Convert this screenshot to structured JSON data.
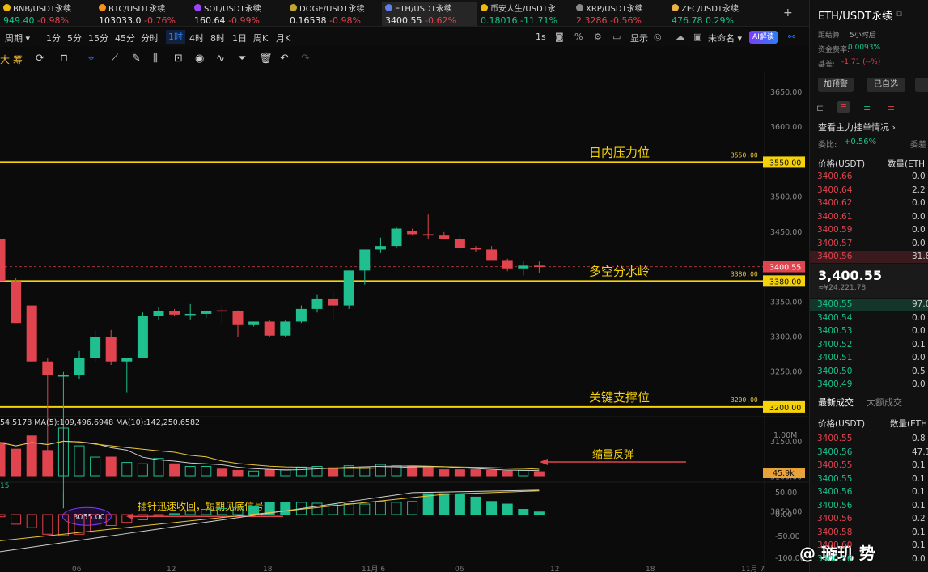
{
  "tickers": [
    {
      "symbol": "BNB/USDT永续",
      "price": "949.40",
      "change": "-0.98%",
      "dir": "neg",
      "color": "#f0b90b"
    },
    {
      "symbol": "BTC/USDT永续",
      "price": "103033.0",
      "change": "-0.76%",
      "dir": "neg",
      "color": "#f7931a"
    },
    {
      "symbol": "SOL/USDT永续",
      "price": "160.64",
      "change": "-0.99%",
      "dir": "neg",
      "color": "#9945ff"
    },
    {
      "symbol": "DOGE/USDT永续",
      "price": "0.16538",
      "change": "-0.98%",
      "dir": "neg",
      "color": "#c2a633"
    },
    {
      "symbol": "ETH/USDT永续",
      "price": "3400.55",
      "change": "-0.62%",
      "dir": "neg",
      "color": "#627eea"
    },
    {
      "symbol": "币安人生/USDT永",
      "price": "0.18016",
      "change": "-11.71%",
      "dir": "pos",
      "color": "#f0b90b"
    },
    {
      "symbol": "XRP/USDT永续",
      "price": "2.3286",
      "change": "-0.56%",
      "dir": "neg",
      "color": "#8a8a8a"
    },
    {
      "symbol": "ZEC/USDT永续",
      "price": "476.78",
      "change": "0.29%",
      "dir": "pos",
      "color": "#ecb244"
    }
  ],
  "add_tab": "+",
  "timeframes": {
    "period": "周期",
    "items": [
      "1分",
      "5分",
      "15分",
      "45分",
      "分时",
      "1时",
      "4时",
      "8时",
      "1日",
      "周K",
      "月K"
    ],
    "selected": "1时"
  },
  "top_right": {
    "interval": "1s",
    "display": "显示",
    "name": "未命名",
    "ai": "AI解读"
  },
  "toolbar_left": "大 筹",
  "chart": {
    "y_ticks": [
      "3650.00",
      "3600.00",
      "3550.00",
      "3500.00",
      "3450.00",
      "3400.00",
      "3350.00",
      "3300.00",
      "3250.00",
      "3200.00",
      "3150.00",
      "3100.00",
      "3050.00"
    ],
    "levels": [
      {
        "value": "3550.00",
        "label": "3550.00",
        "note": "日内压力位"
      },
      {
        "value": "3380.00",
        "label": "3380.00",
        "note": "多空分水岭"
      },
      {
        "value": "3200.00",
        "label": "3200.00",
        "note": "关键支撑位"
      }
    ],
    "current_price": "3400.55",
    "low_marker": "3055.00",
    "low_note": "插针迅速收回，短期见底信号",
    "volume_note": "缩量反弹",
    "ma_text": "54.5178   MA(5):109,496.6948   MA(10):142,250.6582",
    "vol_ticks": [
      "1.00M",
      "500.0k"
    ],
    "vol_current": "45.9k",
    "vol_side_label": "15",
    "macd_ticks": [
      "50.00",
      "0.00",
      "-50.00",
      "-100.00"
    ],
    "x_labels": [
      "06",
      "12",
      "18",
      "11月 6",
      "06",
      "12",
      "18",
      "11月 7"
    ]
  },
  "panel": {
    "symbol": "ETH/USDT永续",
    "expiry_label": "距结算",
    "expiry": "5小时后",
    "funding_label": "资金费率:",
    "funding": "0.0093%",
    "basis_label": "基差:",
    "basis": "-1.71 (--%)",
    "btn_warn": "加预警",
    "btn_fav": "已自选",
    "depth_title": "查看主力挂单情况",
    "ratio_label": "委比:",
    "ratio": "+0.56%",
    "ratio_right": "委差",
    "col_price": "价格(USDT)",
    "col_qty": "数量(ETH",
    "asks": [
      [
        "3400.66",
        "0.0"
      ],
      [
        "3400.64",
        "2.2"
      ],
      [
        "3400.62",
        "0.0"
      ],
      [
        "3400.61",
        "0.0"
      ],
      [
        "3400.59",
        "0.0"
      ],
      [
        "3400.57",
        "0.0"
      ],
      [
        "3400.56",
        "31.8"
      ]
    ],
    "last_price": "3,400.55",
    "last_cny": "≈¥24,221.78",
    "bids": [
      [
        "3400.55",
        "97.0"
      ],
      [
        "3400.54",
        "0.0"
      ],
      [
        "3400.53",
        "0.0"
      ],
      [
        "3400.52",
        "0.1"
      ],
      [
        "3400.51",
        "0.0"
      ],
      [
        "3400.50",
        "0.5"
      ],
      [
        "3400.49",
        "0.0"
      ]
    ],
    "tab_trades": "最新成交",
    "tab_big": "大额成交",
    "trades": [
      [
        "3400.55",
        "0.8",
        "neg"
      ],
      [
        "3400.56",
        "47.1",
        "pos"
      ],
      [
        "3400.55",
        "0.1",
        "neg"
      ],
      [
        "3400.55",
        "0.1",
        "pos"
      ],
      [
        "3400.56",
        "0.1",
        "pos"
      ],
      [
        "3400.56",
        "0.1",
        "pos"
      ],
      [
        "3400.56",
        "0.2",
        "neg"
      ],
      [
        "3400.58",
        "0.1",
        "neg"
      ],
      [
        "3400.60",
        "0.1",
        "neg"
      ],
      [
        "3400.56",
        "0.0",
        "pos"
      ]
    ]
  },
  "watermark": "@ 璇玑  势",
  "colors": {
    "up": "#1fbf8f",
    "down": "#e0444e",
    "level": "#f5d20a",
    "accent": "#2e7df6"
  }
}
